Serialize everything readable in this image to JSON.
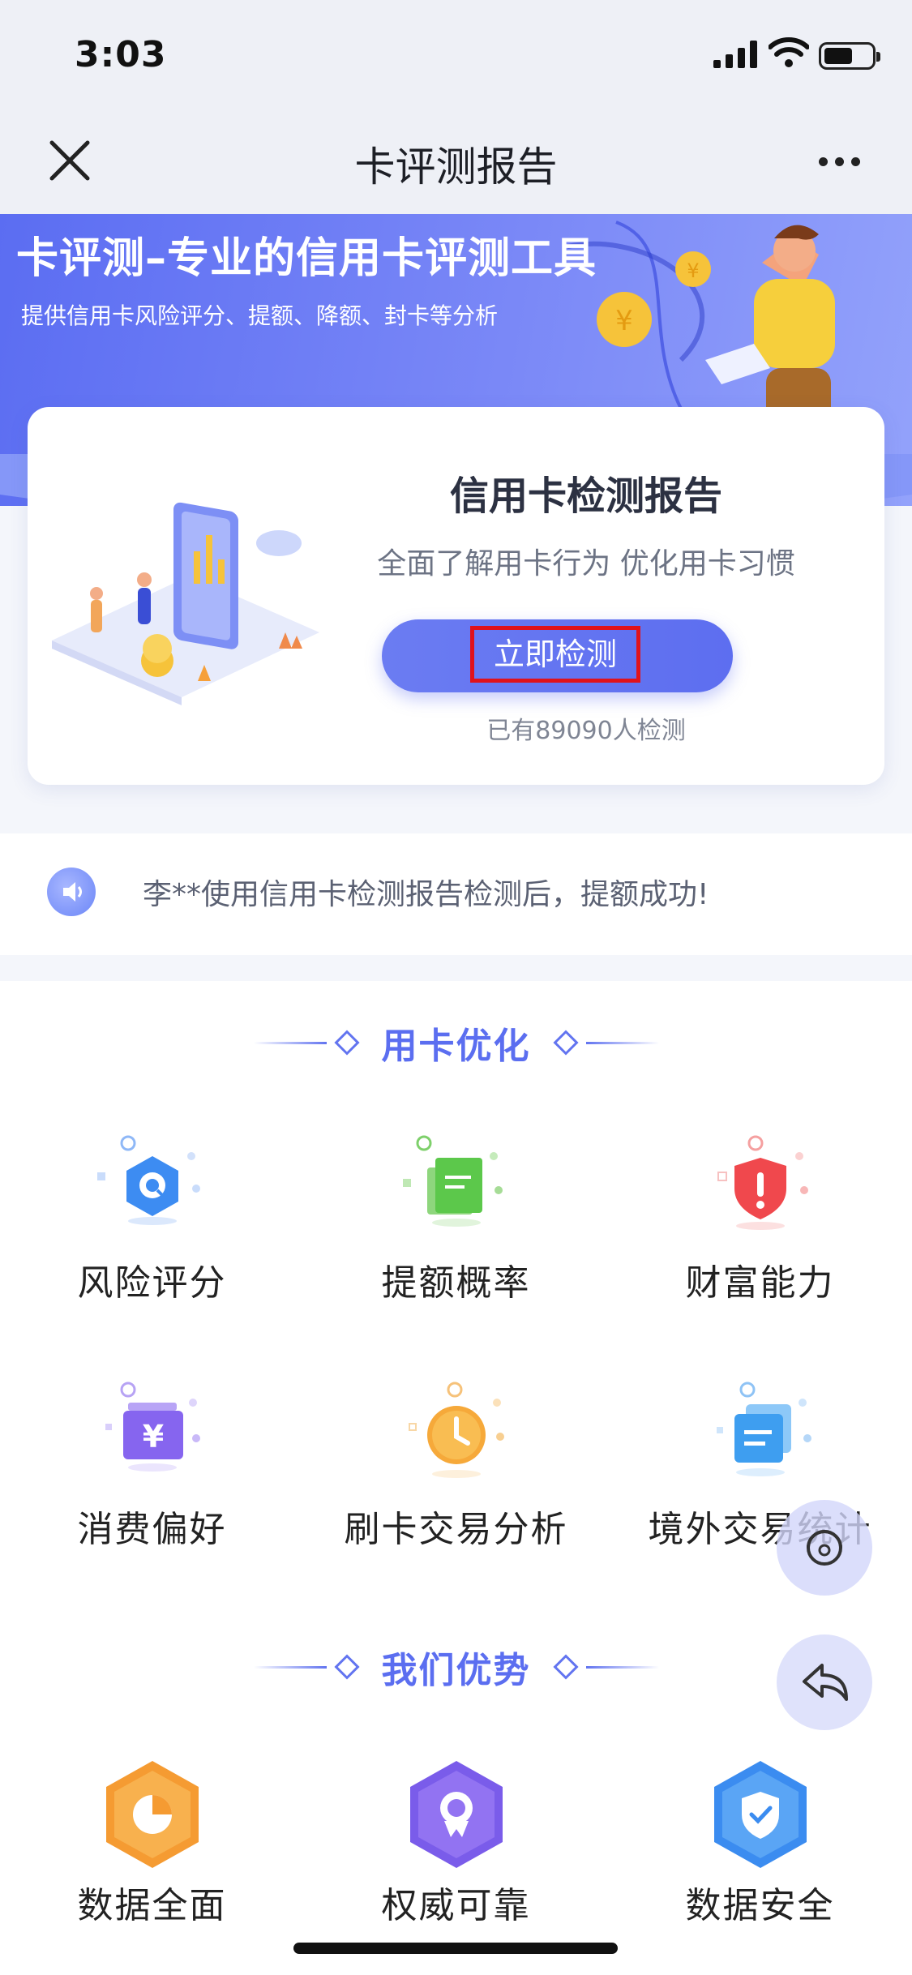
{
  "status": {
    "time": "3:03"
  },
  "nav": {
    "title": "卡评测报告"
  },
  "banner": {
    "title": "卡评测–专业的信用卡评测工具",
    "subtitle": "提供信用卡风险评分、提额、降额、封卡等分析"
  },
  "card": {
    "title": "信用卡检测报告",
    "desc": "全面了解用卡行为 优化用卡习惯",
    "button_label": "立即检测",
    "count_text": "已有89090人检测"
  },
  "notice": {
    "text": "李**使用信用卡检测报告检测后，提额成功!"
  },
  "section_optimize": {
    "title": "用卡优化",
    "items": [
      {
        "label": "风险评分",
        "icon": "risk-score-icon"
      },
      {
        "label": "提额概率",
        "icon": "limit-probability-icon"
      },
      {
        "label": "财富能力",
        "icon": "wealth-icon"
      },
      {
        "label": "消费偏好",
        "icon": "consumption-icon"
      },
      {
        "label": "刷卡交易分析",
        "icon": "transaction-clock-icon"
      },
      {
        "label": "境外交易统计",
        "icon": "overseas-stats-icon"
      }
    ]
  },
  "section_advantage": {
    "title": "我们优势",
    "items": [
      {
        "label": "数据全面",
        "icon": "pie-chart-icon"
      },
      {
        "label": "权威可靠",
        "icon": "award-icon"
      },
      {
        "label": "数据安全",
        "icon": "shield-check-icon"
      }
    ]
  },
  "colors": {
    "accent": "#5b6ef0",
    "highlight_border": "#e0121b"
  }
}
